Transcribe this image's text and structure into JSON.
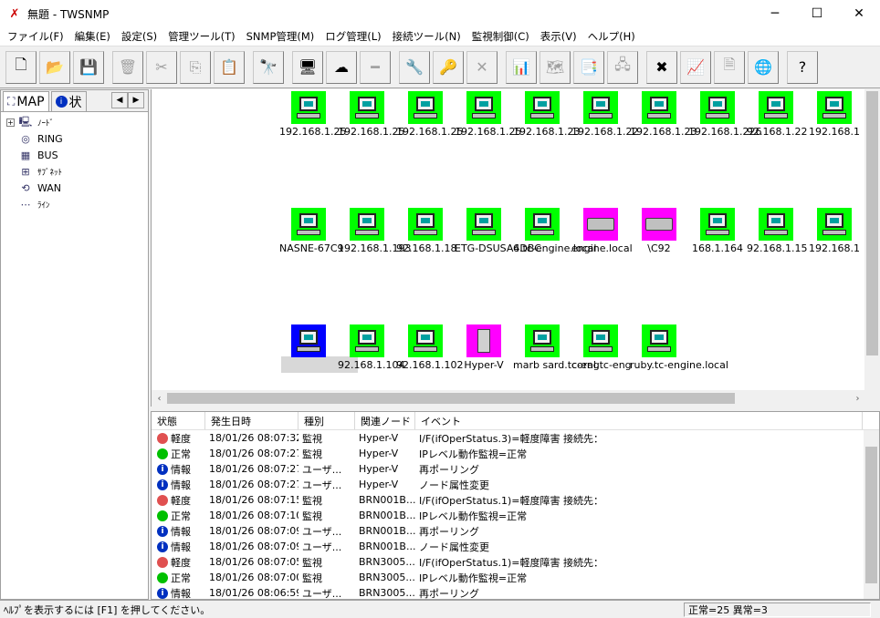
{
  "window": {
    "title": "無題 - TWSNMP",
    "app_icon": "twsnmp-logo-icon",
    "controls": [
      "minimize",
      "maximize",
      "close"
    ]
  },
  "menu": [
    "ファイル(F)",
    "編集(E)",
    "設定(S)",
    "管理ツール(T)",
    "SNMP管理(M)",
    "ログ管理(L)",
    "接続ツール(N)",
    "監視制御(C)",
    "表示(V)",
    "ヘルプ(H)"
  ],
  "toolbar": [
    {
      "icon": "new-file-icon",
      "glyph": "🗋",
      "enabled": true
    },
    {
      "icon": "open-folder-icon",
      "glyph": "📂",
      "enabled": true
    },
    {
      "icon": "save-icon",
      "glyph": "💾",
      "enabled": true
    },
    {
      "icon": "trash-icon",
      "glyph": "🗑",
      "enabled": false
    },
    {
      "icon": "cut-icon",
      "glyph": "✂",
      "enabled": false
    },
    {
      "icon": "copy-icon",
      "glyph": "⎘",
      "enabled": false
    },
    {
      "icon": "paste-icon",
      "glyph": "📋",
      "enabled": false
    },
    {
      "icon": "find-icon",
      "glyph": "🔭",
      "enabled": true
    },
    {
      "icon": "add-node-icon",
      "glyph": "🖥",
      "enabled": true
    },
    {
      "icon": "add-cloud-icon",
      "glyph": "☁",
      "enabled": true
    },
    {
      "icon": "add-line-icon",
      "glyph": "━",
      "enabled": false
    },
    {
      "icon": "tools-icon",
      "glyph": "🔧",
      "enabled": false
    },
    {
      "icon": "key-icon",
      "glyph": "🔑",
      "enabled": true
    },
    {
      "icon": "delete-icon",
      "glyph": "✕",
      "enabled": false
    },
    {
      "icon": "report-icon",
      "glyph": "📊",
      "enabled": true
    },
    {
      "icon": "map-icon",
      "glyph": "🗺",
      "enabled": false
    },
    {
      "icon": "node-list-icon",
      "glyph": "📑",
      "enabled": false
    },
    {
      "icon": "server-icon",
      "glyph": "🖧",
      "enabled": false
    },
    {
      "icon": "alert-window-icon",
      "glyph": "✖",
      "enabled": true
    },
    {
      "icon": "chart-icon",
      "glyph": "📈",
      "enabled": true
    },
    {
      "icon": "mib-icon",
      "glyph": "🗎",
      "enabled": false
    },
    {
      "icon": "browser-icon",
      "glyph": "🌐",
      "enabled": false
    },
    {
      "icon": "help-icon",
      "glyph": "?",
      "enabled": true
    }
  ],
  "left_pane": {
    "tabs": [
      {
        "icon": "map-tab-icon",
        "label": "MAP"
      },
      {
        "icon": "info-tab-icon",
        "label": "状"
      }
    ],
    "tree": [
      {
        "icon": "node-tree-icon",
        "label": "ﾉｰﾄﾞ",
        "expandable": true
      },
      {
        "icon": "ring-tree-icon",
        "label": "RING"
      },
      {
        "icon": "bus-tree-icon",
        "label": "BUS"
      },
      {
        "icon": "subnet-tree-icon",
        "label": "ｻﾌﾞﾈｯﾄ"
      },
      {
        "icon": "wan-tree-icon",
        "label": "WAN"
      },
      {
        "icon": "line-tree-icon",
        "label": "ﾗｲﾝ"
      }
    ]
  },
  "map": {
    "rows": [
      [
        {
          "label": "192.168.1.25",
          "color": "#00ff00",
          "type": "pc"
        },
        {
          "label": "192.168.1.25",
          "color": "#00ff00",
          "type": "pc"
        },
        {
          "label": "192.168.1.25",
          "color": "#00ff00",
          "type": "pc"
        },
        {
          "label": "192.168.1.25",
          "color": "#00ff00",
          "type": "pc"
        },
        {
          "label": "192.168.1.23",
          "color": "#00ff00",
          "type": "pc"
        },
        {
          "label": "192.168.1.22",
          "color": "#00ff00",
          "type": "pc"
        },
        {
          "label": "192.168.1.23",
          "color": "#00ff00",
          "type": "pc"
        },
        {
          "label": "192.168.1.226",
          "color": "#00ff00",
          "type": "pc"
        },
        {
          "label": "92.168.1.22",
          "color": "#00ff00",
          "type": "pc"
        },
        {
          "label": "192.168.1",
          "color": "#00ff00",
          "type": "pc"
        }
      ],
      [
        {
          "label": "NASNE-67C9",
          "color": "#00ff00",
          "type": "pc"
        },
        {
          "label": "192.168.1.193",
          "color": "#00ff00",
          "type": "pc"
        },
        {
          "label": "92.168.1.18",
          "color": "#00ff00",
          "type": "pc"
        },
        {
          "label": "ETG-DSUSA4DBC",
          "color": "#00ff00",
          "type": "pc"
        },
        {
          "label": "6.tc-engine.local",
          "color": "#00ff00",
          "type": "pc"
        },
        {
          "label": "engine.local",
          "color": "#ff00ff",
          "type": "router"
        },
        {
          "label": "\\C92",
          "color": "#ff00ff",
          "type": "router"
        },
        {
          "label": "168.1.164",
          "color": "#00ff00",
          "type": "pc"
        },
        {
          "label": "92.168.1.15",
          "color": "#00ff00",
          "type": "pc"
        },
        {
          "label": "192.168.1",
          "color": "#00ff00",
          "type": "pc"
        }
      ],
      [
        {
          "label": "",
          "color": "#0000ff",
          "type": "pc"
        },
        {
          "label": "92.168.1.104",
          "color": "#00ff00",
          "type": "pc"
        },
        {
          "label": "92.168.1.102",
          "color": "#00ff00",
          "type": "pc"
        },
        {
          "label": "Hyper-V",
          "color": "#ff00ff",
          "type": "phone"
        },
        {
          "label": "marb sard.tc-eng",
          "color": "#00ff00",
          "type": "pc"
        },
        {
          "label": "coral.tc-eng",
          "color": "#00ff00",
          "type": "pc"
        },
        {
          "label": "ruby.tc-engine.local",
          "color": "#00ff00",
          "type": "pc"
        }
      ]
    ]
  },
  "log": {
    "headers": [
      "状態",
      "発生日時",
      "種別",
      "関連ノード",
      "イベント"
    ],
    "rows": [
      {
        "sev": "軽度",
        "sev_color": "#e05050",
        "time": "18/01/26 08:07:32",
        "type": "監視",
        "node": "Hyper-V",
        "event": "I/F(ifOperStatus.3)=軽度障害 接続先："
      },
      {
        "sev": "正常",
        "sev_color": "#00c000",
        "time": "18/01/26 08:07:27",
        "type": "監視",
        "node": "Hyper-V",
        "event": "IPレベル動作監視=正常"
      },
      {
        "sev": "情報",
        "sev_color": "#0030c0",
        "time": "18/01/26 08:07:27",
        "type": "ユーザ...",
        "node": "Hyper-V",
        "event": "再ポーリング"
      },
      {
        "sev": "情報",
        "sev_color": "#0030c0",
        "time": "18/01/26 08:07:27",
        "type": "ユーザ...",
        "node": "Hyper-V",
        "event": "ノード属性変更"
      },
      {
        "sev": "軽度",
        "sev_color": "#e05050",
        "time": "18/01/26 08:07:15",
        "type": "監視",
        "node": "BRN001B...",
        "event": "I/F(ifOperStatus.1)=軽度障害 接続先："
      },
      {
        "sev": "正常",
        "sev_color": "#00c000",
        "time": "18/01/26 08:07:10",
        "type": "監視",
        "node": "BRN001B...",
        "event": "IPレベル動作監視=正常"
      },
      {
        "sev": "情報",
        "sev_color": "#0030c0",
        "time": "18/01/26 08:07:09",
        "type": "ユーザ...",
        "node": "BRN001B...",
        "event": "再ポーリング"
      },
      {
        "sev": "情報",
        "sev_color": "#0030c0",
        "time": "18/01/26 08:07:09",
        "type": "ユーザ...",
        "node": "BRN001B...",
        "event": "ノード属性変更"
      },
      {
        "sev": "軽度",
        "sev_color": "#e05050",
        "time": "18/01/26 08:07:05",
        "type": "監視",
        "node": "BRN3005...",
        "event": "I/F(ifOperStatus.1)=軽度障害 接続先："
      },
      {
        "sev": "正常",
        "sev_color": "#00c000",
        "time": "18/01/26 08:07:00",
        "type": "監視",
        "node": "BRN3005...",
        "event": "IPレベル動作監視=正常"
      },
      {
        "sev": "情報",
        "sev_color": "#0030c0",
        "time": "18/01/26 08:06:59",
        "type": "ユーザ...",
        "node": "BRN3005...",
        "event": "再ポーリング"
      }
    ]
  },
  "status": {
    "help": "ﾍﾙﾌﾟを表示するには [F1] を押してください。",
    "counts": "正常=25 異常=3"
  }
}
